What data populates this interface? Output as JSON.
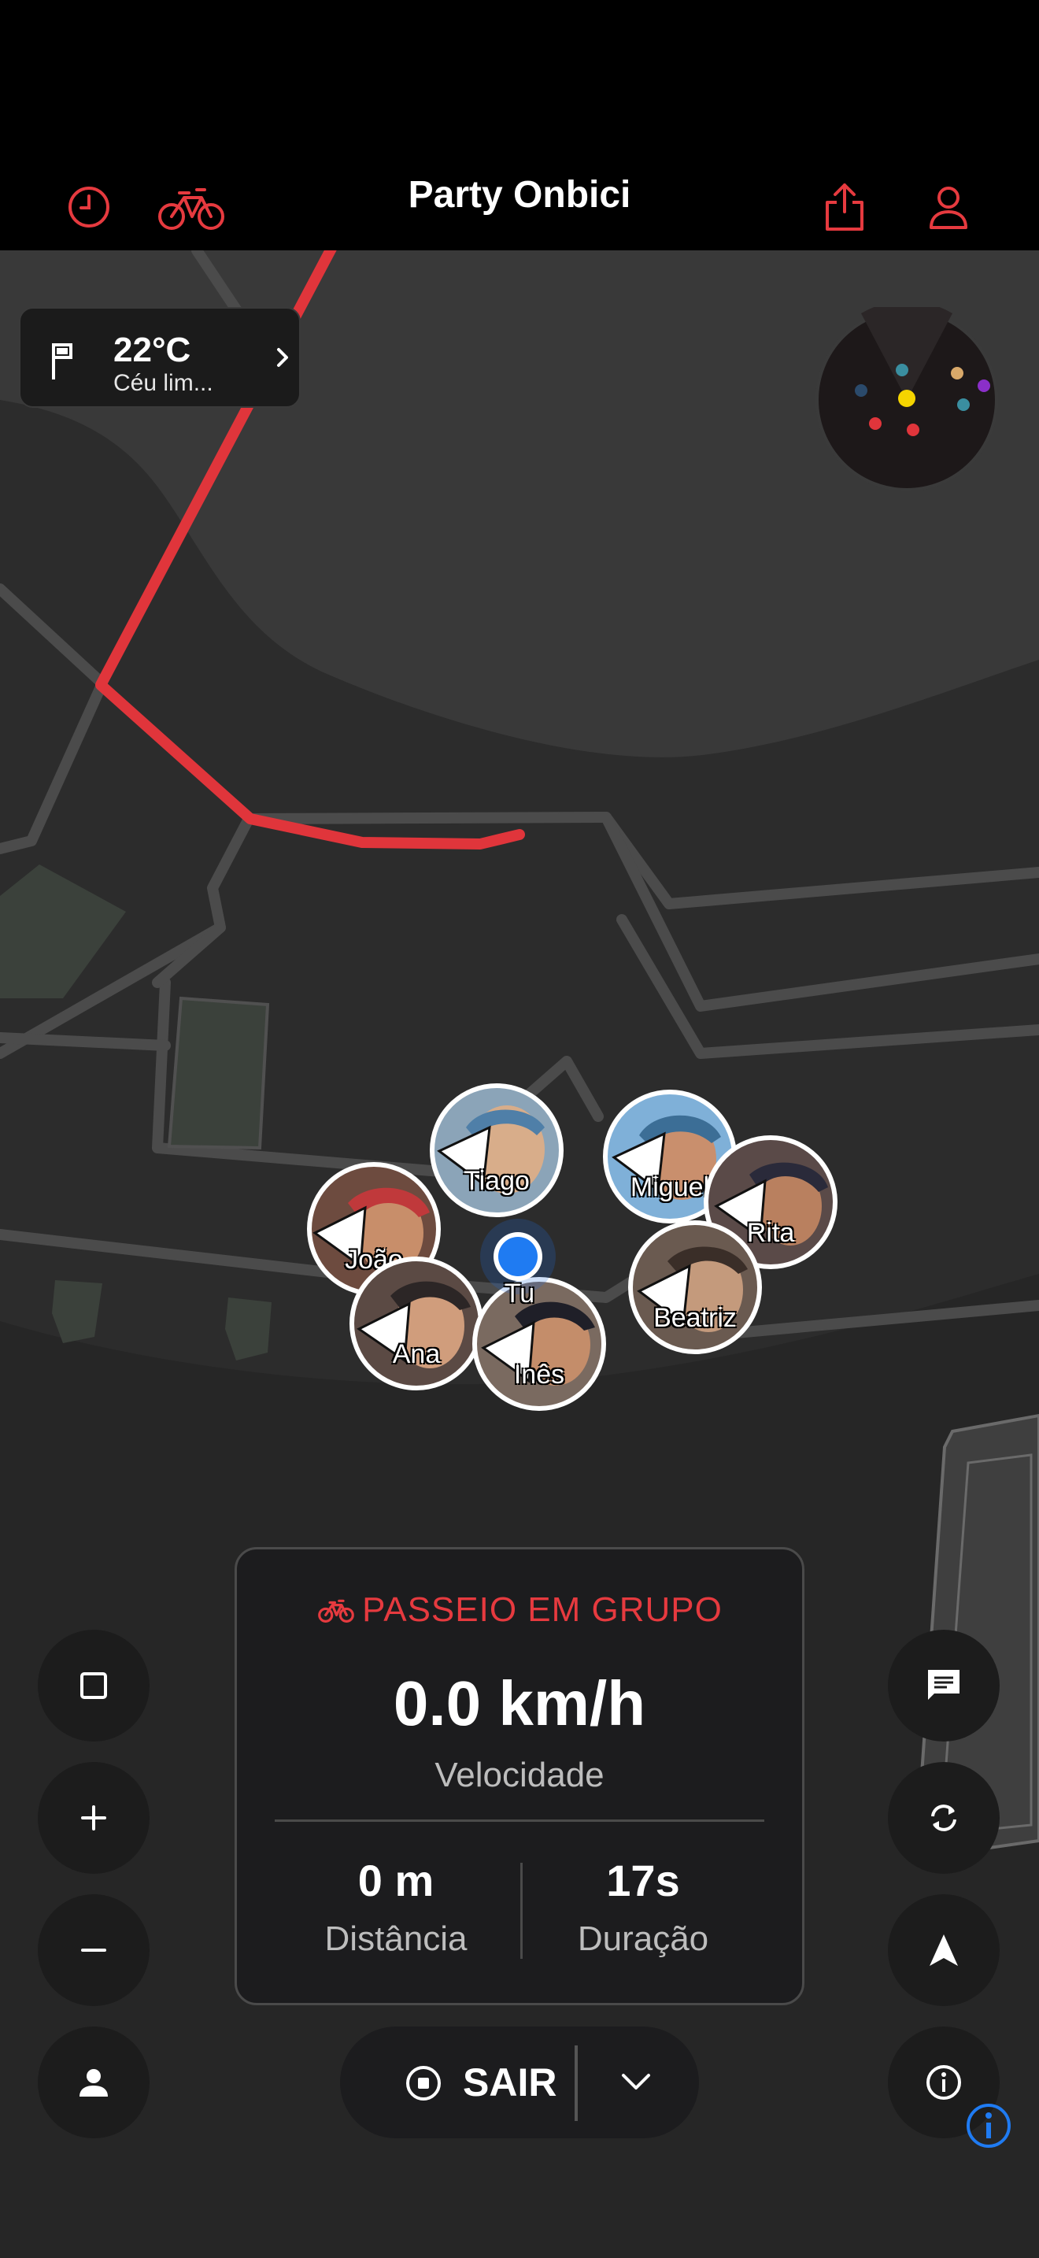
{
  "header": {
    "title": "Party Onbici",
    "icons": [
      "history-icon",
      "bike-icon",
      "share-icon",
      "profile-icon"
    ],
    "accent_color": "#e63a3f"
  },
  "weather": {
    "temp": "22°C",
    "description": "Céu lim..."
  },
  "riders": [
    {
      "name": "Tiago"
    },
    {
      "name": "Miguel"
    },
    {
      "name": "Rita"
    },
    {
      "name": "João"
    },
    {
      "name": "Beatriz"
    },
    {
      "name": "Ana"
    },
    {
      "name": "Inês"
    }
  ],
  "me": {
    "label": "Tu"
  },
  "stats": {
    "mode": "PASSEIO EM GRUPO",
    "speed": "0.0 km/h",
    "speed_label": "Velocidade",
    "distance": "0 m",
    "distance_label": "Distância",
    "duration": "17s",
    "duration_label": "Duração"
  },
  "exit": {
    "label": "SAIR"
  }
}
